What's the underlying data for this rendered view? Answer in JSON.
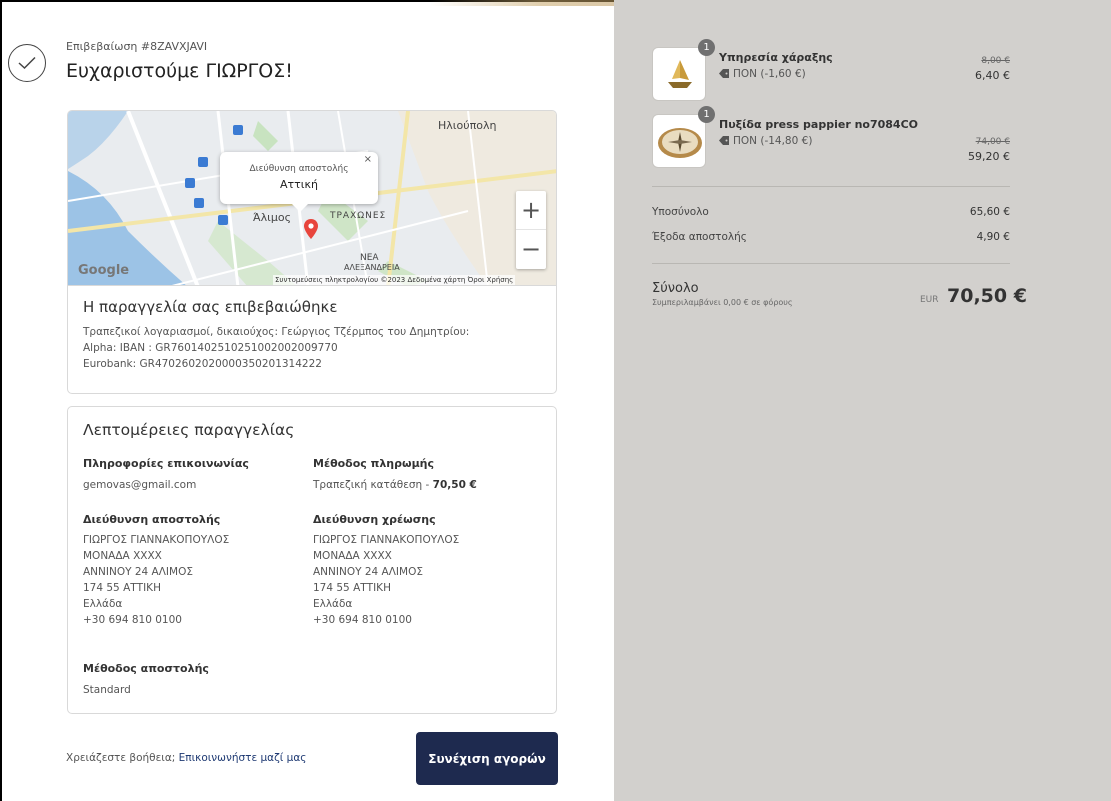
{
  "confirmation": {
    "label": "Επιβεβαίωση #8ZAVXJAVI",
    "thanks": "Ευχαριστούμε ΓΙΩΡΓΟΣ!"
  },
  "map": {
    "popup_label": "Διεύθυνση αποστολής",
    "popup_value": "Αττική",
    "label_ilioupoli": "Ηλιούπολη",
    "label_alimos": "Άλιμος",
    "label_trachones": "ΤΡΑΧΩΝΕΣ",
    "label_nea": "ΝΕΑ",
    "label_alexandreia": "ΑΛΕΞΑΝΔΡΕΙΑ",
    "logo": "Google",
    "attribution": "Συντομεύσεις πληκτρολογίου  ©2023 Δεδομένα χάρτη  Όροι Χρήσης",
    "zoom_in": "+",
    "zoom_out": "−",
    "close": "×"
  },
  "order_confirmed": {
    "heading": "Η παραγγελία σας επιβεβαιώθηκε",
    "line1": "Τραπεζικοί λογαριασμοί, δικαιούχος: Γεώργιος Τζέρμπος του Δημητρίου:",
    "line2": "Alpha: IBAN : GR7601402510251002002009770",
    "line3": "Eurobank: GR4702602020000350201314222"
  },
  "details": {
    "heading": "Λεπτομέρειες παραγγελίας",
    "contact_label": "Πληροφορίες επικοινωνίας",
    "contact_value": "gemovas@gmail.com",
    "payment_label": "Μέθοδος πληρωμής",
    "payment_value": "Τραπεζική κατάθεση - ",
    "payment_amount": "70,50 €",
    "shipping_addr_label": "Διεύθυνση αποστολής",
    "shipping_addr": [
      "ΓΙΩΡΓΟΣ ΓΙΑΝΝΑΚΟΠΟΥΛΟΣ",
      "ΜΟΝΑΔΑ XXXX",
      "ΑΝΝΙΝΟΥ 24 ΑΛΙΜΟΣ",
      "174 55 ΑΤΤΙΚΗ",
      "Ελλάδα",
      "+30 694 810 0100"
    ],
    "billing_addr_label": "Διεύθυνση χρέωσης",
    "billing_addr": [
      "ΓΙΩΡΓΟΣ ΓΙΑΝΝΑΚΟΠΟΥΛΟΣ",
      "ΜΟΝΑΔΑ XXXX",
      "ΑΝΝΙΝΟΥ 24 ΑΛΙΜΟΣ",
      "174 55 ΑΤΤΙΚΗ",
      "Ελλάδα",
      "+30 694 810 0100"
    ],
    "shipping_method_label": "Μέθοδος αποστολής",
    "shipping_method_value": "Standard"
  },
  "footer": {
    "help_text": "Χρειάζεστε βοήθεια; ",
    "help_link": "Επικοινωνήστε μαζί μας",
    "continue_button": "Συνέχιση αγορών"
  },
  "cart": {
    "items": [
      {
        "qty": "1",
        "name": "Υπηρεσία χάραξης",
        "discount": "ΠΟΝ (-1,60 €)",
        "old_price": "8,00 €",
        "price": "6,40 €",
        "icon": "boat-icon"
      },
      {
        "qty": "1",
        "name": "Πυξίδα press pappier no7084CO",
        "discount": "ΠΟΝ (-14,80 €)",
        "old_price": "74,00 €",
        "price": "59,20 €",
        "icon": "compass-icon"
      }
    ],
    "subtotal_label": "Υποσύνολο",
    "subtotal_value": "65,60 €",
    "shipping_label": "Έξοδα αποστολής",
    "shipping_value": "4,90 €",
    "total_label": "Σύνολο",
    "total_sub": "Συμπεριλαμβάνει 0,00 € σε φόρους",
    "currency": "EUR",
    "total_value": "70,50 €"
  },
  "colors": {
    "button_bg": "#1e2a4f",
    "right_panel_bg": "#d2d0cd",
    "link": "#1f3a73"
  }
}
